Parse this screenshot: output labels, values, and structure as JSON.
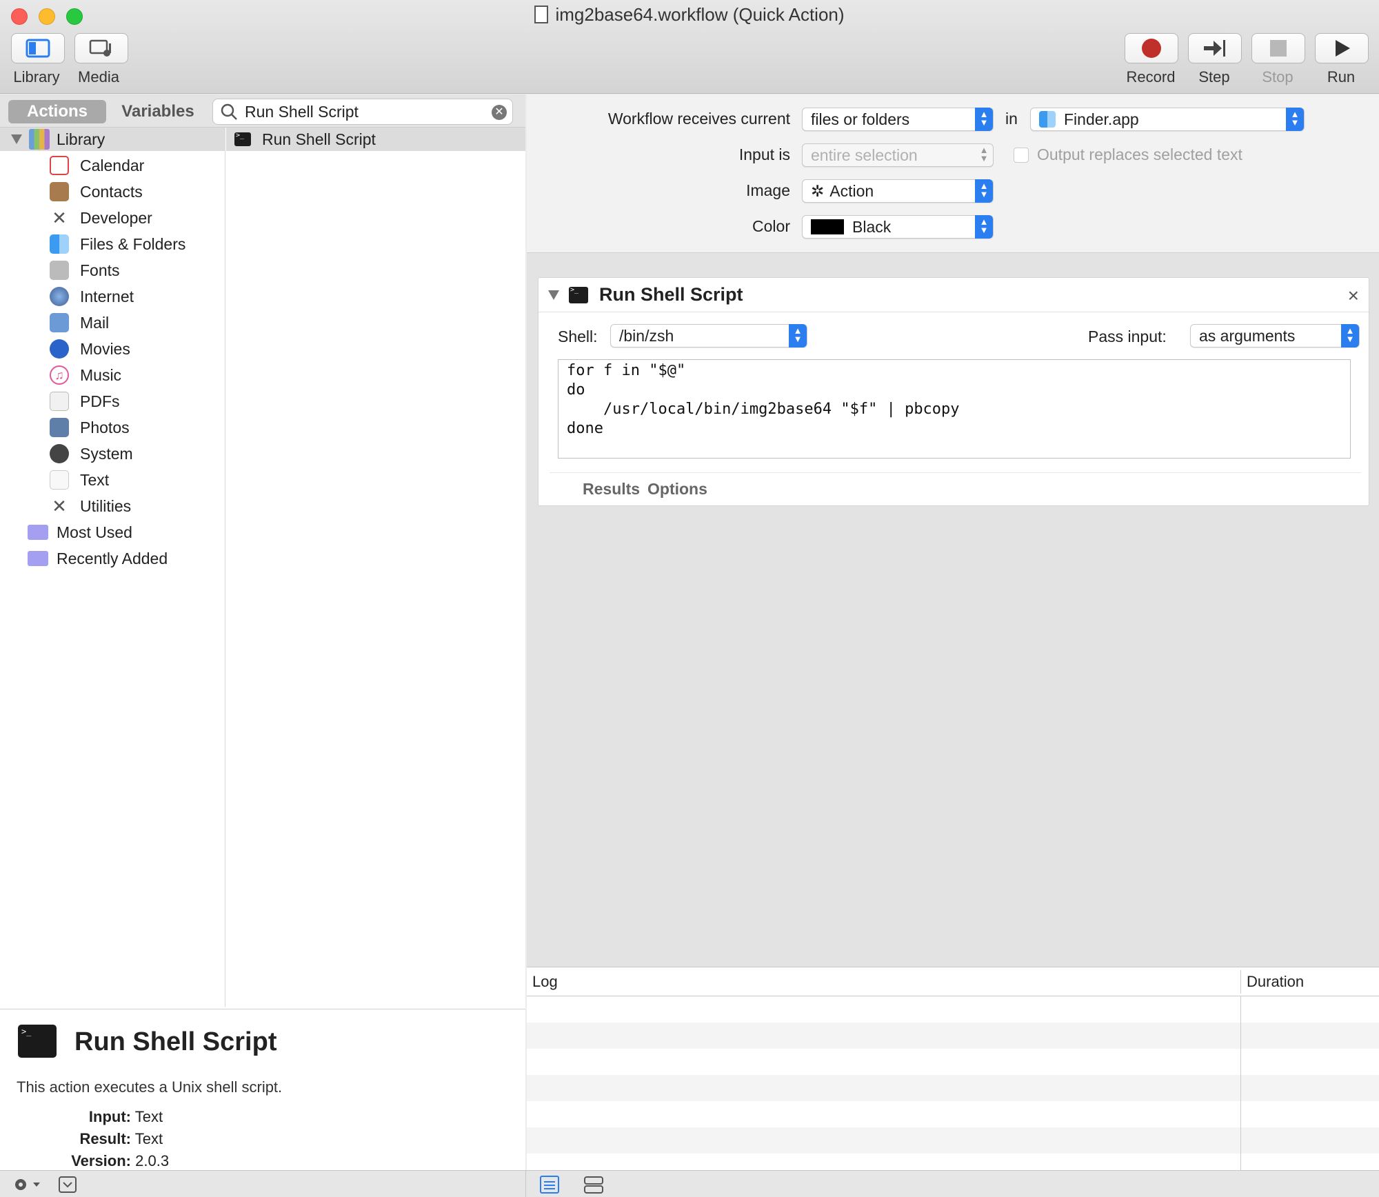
{
  "window": {
    "title": "img2base64.workflow (Quick Action)"
  },
  "toolbar": {
    "library_label": "Library",
    "media_label": "Media",
    "record_label": "Record",
    "step_label": "Step",
    "stop_label": "Stop",
    "run_label": "Run"
  },
  "tabs": {
    "actions": "Actions",
    "variables": "Variables"
  },
  "search": {
    "value": "Run Shell Script"
  },
  "library": {
    "root": "Library",
    "items": [
      "Calendar",
      "Contacts",
      "Developer",
      "Files & Folders",
      "Fonts",
      "Internet",
      "Mail",
      "Movies",
      "Music",
      "PDFs",
      "Photos",
      "System",
      "Text",
      "Utilities"
    ],
    "extra": [
      "Most Used",
      "Recently Added"
    ]
  },
  "actions_list": [
    "Run Shell Script"
  ],
  "description": {
    "title": "Run Shell Script",
    "text": "This action executes a Unix shell script.",
    "input_label": "Input:",
    "input_value": "Text",
    "result_label": "Result:",
    "result_value": "Text",
    "version_label": "Version:",
    "version_value": "2.0.3"
  },
  "workflow": {
    "receives_label": "Workflow receives current",
    "receives_value": "files or folders",
    "in_label": "in",
    "app_value": "Finder.app",
    "input_is_label": "Input is",
    "input_is_value": "entire selection",
    "output_replaces_label": "Output replaces selected text",
    "image_label": "Image",
    "image_value": "Action",
    "color_label": "Color",
    "color_value": "Black"
  },
  "action_card": {
    "title": "Run Shell Script",
    "shell_label": "Shell:",
    "shell_value": "/bin/zsh",
    "pass_input_label": "Pass input:",
    "pass_input_value": "as arguments",
    "script": "for f in \"$@\"\ndo\n    /usr/local/bin/img2base64 \"$f\" | pbcopy\ndone",
    "results_tab": "Results",
    "options_tab": "Options"
  },
  "log": {
    "col_log": "Log",
    "col_duration": "Duration"
  },
  "colors": {
    "accent": "#2b7ef0",
    "record": "#c0302a"
  }
}
